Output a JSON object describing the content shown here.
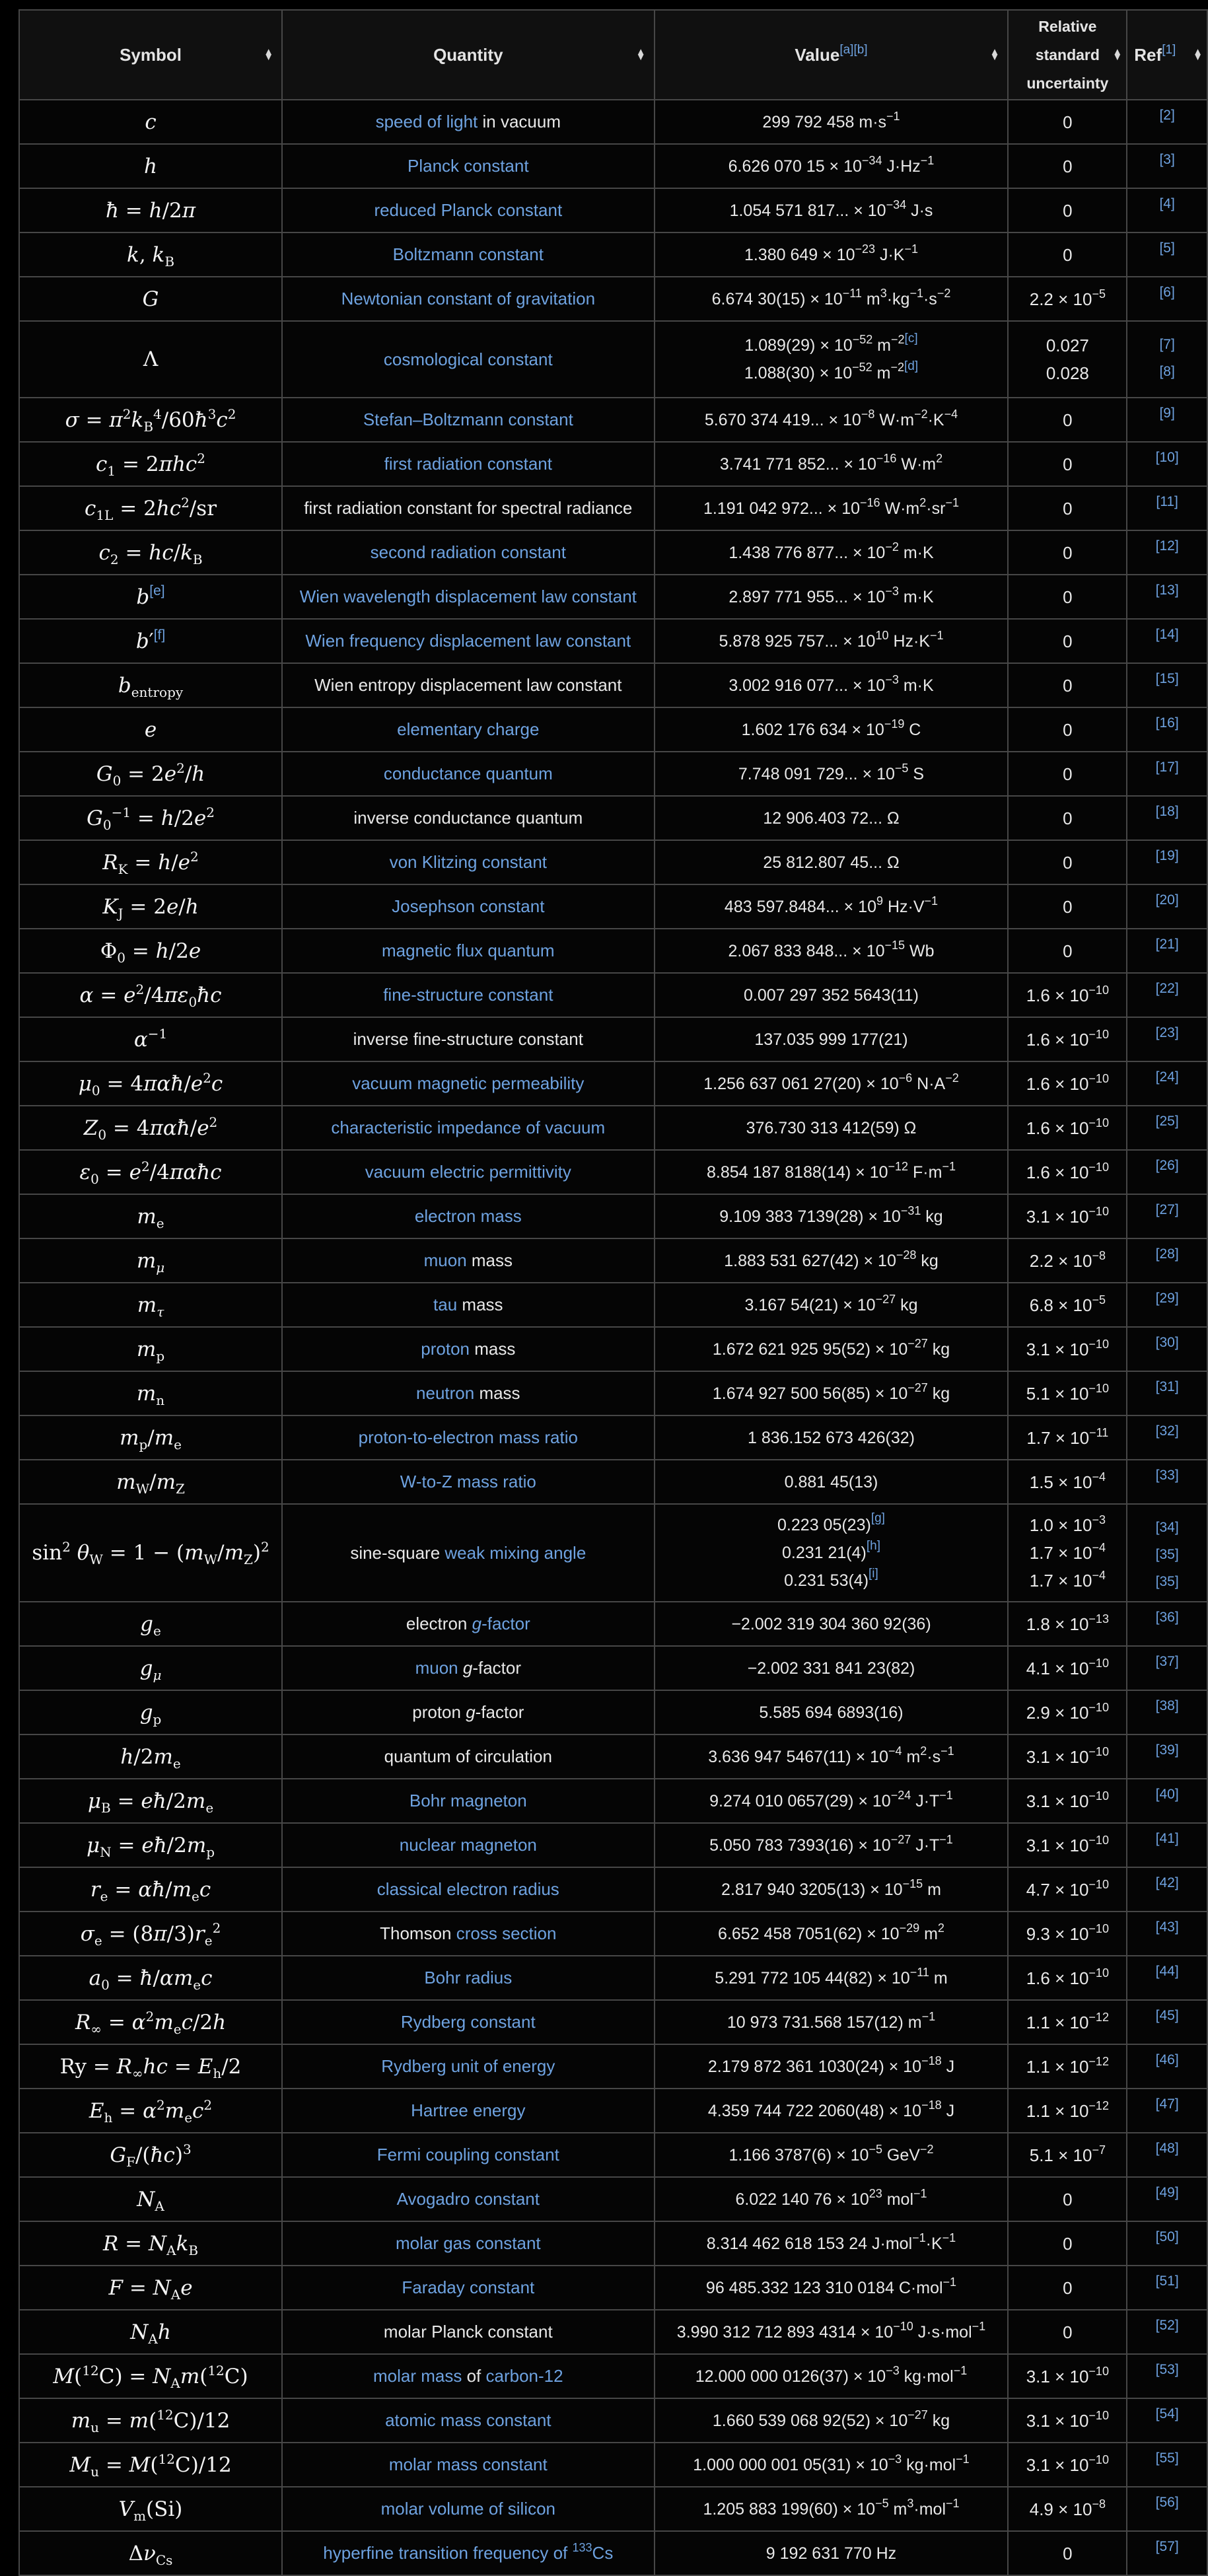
{
  "header": {
    "symbol": "Symbol",
    "quantity": "Quantity",
    "value": "Value",
    "value_notes": "[a][b]",
    "uncertainty_lines": [
      "Relative",
      "standard",
      "uncertainty"
    ],
    "ref": "Ref",
    "ref_note": "[1]",
    "sort_icon": "sort-updown-icon"
  },
  "colors": {
    "link": "#6ea2e0",
    "text": "#e8e8e8",
    "background": "#050505",
    "header_bg": "#101010",
    "border": "#474747"
  },
  "rows": [
    {
      "symbol": "<i>c</i>",
      "quantity": [
        [
          "link",
          "speed of light"
        ],
        [
          "plain",
          " in vacuum"
        ]
      ],
      "values": [
        "299 792 458 m·s^{−1}"
      ],
      "unc": [
        "0"
      ],
      "refs": [
        "[2]"
      ]
    },
    {
      "symbol": "<i>h</i>",
      "quantity": [
        [
          "link",
          "Planck constant"
        ]
      ],
      "values": [
        "6.626 070 15 × 10^{−34} J·Hz^{−1}"
      ],
      "unc": [
        "0"
      ],
      "refs": [
        "[3]"
      ]
    },
    {
      "symbol": "<i>ħ</i> = <i>h</i>/2<i>π</i>",
      "quantity": [
        [
          "link",
          "reduced Planck constant"
        ]
      ],
      "values": [
        "1.054 571 817... × 10^{−34} J·s"
      ],
      "unc": [
        "0"
      ],
      "refs": [
        "[4]"
      ]
    },
    {
      "symbol": "<i>k</i>, <i>k</i>_{B}",
      "quantity": [
        [
          "link",
          "Boltzmann constant"
        ]
      ],
      "values": [
        "1.380 649 × 10^{−23} J·K^{−1}"
      ],
      "unc": [
        "0"
      ],
      "refs": [
        "[5]"
      ]
    },
    {
      "symbol": "<i>G</i>",
      "quantity": [
        [
          "link",
          "Newtonian constant of gravitation"
        ]
      ],
      "values": [
        "6.674 30(15) × 10^{−11} m^{3}·kg^{−1}·s^{−2}"
      ],
      "unc": [
        "2.2 × 10^{−5}"
      ],
      "refs": [
        "[6]"
      ]
    },
    {
      "symbol": "Λ",
      "quantity": [
        [
          "link",
          "cosmological constant"
        ]
      ],
      "values": [
        "1.089(29) × 10^{−52} m^{−2}{fn:[c]}",
        "1.088(30) × 10^{−52} m^{−2}{fn:[d]}"
      ],
      "unc": [
        "0.027",
        "0.028"
      ],
      "refs": [
        "[7]",
        "[8]"
      ],
      "size": "mid"
    },
    {
      "symbol": "<i>σ</i> = <i>π</i>^{2}<i>k</i>_{B}^{4}/60<i>ħ</i>^{3}<i>c</i>^{2}",
      "quantity": [
        [
          "link",
          "Stefan–Boltzmann constant"
        ]
      ],
      "values": [
        "5.670 374 419... × 10^{−8} W·m^{−2}·K^{−4}"
      ],
      "unc": [
        "0"
      ],
      "refs": [
        "[9]"
      ]
    },
    {
      "symbol": "<i>c</i>_{1} = 2<i>πhc</i>^{2}",
      "quantity": [
        [
          "link",
          "first radiation constant"
        ]
      ],
      "values": [
        "3.741 771 852... × 10^{−16} W·m^{2}"
      ],
      "unc": [
        "0"
      ],
      "refs": [
        "[10]"
      ]
    },
    {
      "symbol": "<i>c</i>_{1L} = 2<i>hc</i>^{2}/sr",
      "quantity": [
        [
          "plain",
          "first radiation constant for spectral radiance"
        ]
      ],
      "values": [
        "1.191 042 972... × 10^{−16} W·m^{2}·sr^{−1}"
      ],
      "unc": [
        "0"
      ],
      "refs": [
        "[11]"
      ]
    },
    {
      "symbol": "<i>c</i>_{2} = <i>hc</i>/<i>k</i>_{B}",
      "quantity": [
        [
          "link",
          "second radiation constant"
        ]
      ],
      "values": [
        "1.438 776 877... × 10^{−2} m·K"
      ],
      "unc": [
        "0"
      ],
      "refs": [
        "[12]"
      ]
    },
    {
      "symbol": "<i>b</i>{fn:[e]}",
      "quantity": [
        [
          "link",
          "Wien wavelength displacement law constant"
        ]
      ],
      "values": [
        "2.897 771 955... × 10^{−3} m·K"
      ],
      "unc": [
        "0"
      ],
      "refs": [
        "[13]"
      ]
    },
    {
      "symbol": "<i>b</i>′{fn:[f]}",
      "quantity": [
        [
          "link",
          "Wien frequency displacement law constant"
        ]
      ],
      "values": [
        "5.878 925 757... × 10^{10} Hz·K^{−1}"
      ],
      "unc": [
        "0"
      ],
      "refs": [
        "[14]"
      ]
    },
    {
      "symbol": "<i>b</i>_{entropy}",
      "quantity": [
        [
          "plain",
          "Wien entropy displacement law constant"
        ]
      ],
      "values": [
        "3.002 916 077... × 10^{−3} m·K"
      ],
      "unc": [
        "0"
      ],
      "refs": [
        "[15]"
      ]
    },
    {
      "symbol": "<i>e</i>",
      "quantity": [
        [
          "link",
          "elementary charge"
        ]
      ],
      "values": [
        "1.602 176 634 × 10^{−19} C"
      ],
      "unc": [
        "0"
      ],
      "refs": [
        "[16]"
      ]
    },
    {
      "symbol": "<i>G</i>_{0} = 2<i>e</i>^{2}/<i>h</i>",
      "quantity": [
        [
          "link",
          "conductance quantum"
        ]
      ],
      "values": [
        "7.748 091 729... × 10^{−5} S"
      ],
      "unc": [
        "0"
      ],
      "refs": [
        "[17]"
      ]
    },
    {
      "symbol": "<i>G</i>_{0}^{−1} = <i>h</i>/2<i>e</i>^{2}",
      "quantity": [
        [
          "plain",
          "inverse conductance quantum"
        ]
      ],
      "values": [
        "12 906.403 72... Ω"
      ],
      "unc": [
        "0"
      ],
      "refs": [
        "[18]"
      ]
    },
    {
      "symbol": "<i>R</i>_{K} = <i>h</i>/<i>e</i>^{2}",
      "quantity": [
        [
          "link",
          "von Klitzing constant"
        ]
      ],
      "values": [
        "25 812.807 45... Ω"
      ],
      "unc": [
        "0"
      ],
      "refs": [
        "[19]"
      ]
    },
    {
      "symbol": "<i>K</i>_{J} = 2<i>e</i>/<i>h</i>",
      "quantity": [
        [
          "link",
          "Josephson constant"
        ]
      ],
      "values": [
        "483 597.8484... × 10^{9} Hz·V^{−1}"
      ],
      "unc": [
        "0"
      ],
      "refs": [
        "[20]"
      ]
    },
    {
      "symbol": "Φ_{0} = <i>h</i>/2<i>e</i>",
      "quantity": [
        [
          "link",
          "magnetic flux quantum"
        ]
      ],
      "values": [
        "2.067 833 848... × 10^{−15} Wb"
      ],
      "unc": [
        "0"
      ],
      "refs": [
        "[21]"
      ]
    },
    {
      "symbol": "<i>α</i> = <i>e</i>^{2}/4<i>πε</i>_{0}<i>ħc</i>",
      "quantity": [
        [
          "link",
          "fine-structure constant"
        ]
      ],
      "values": [
        "0.007 297 352 5643(11)"
      ],
      "unc": [
        "1.6 × 10^{−10}"
      ],
      "refs": [
        "[22]"
      ]
    },
    {
      "symbol": "<i>α</i>^{−1}",
      "quantity": [
        [
          "plain",
          "inverse fine-structure constant"
        ]
      ],
      "values": [
        "137.035 999 177(21)"
      ],
      "unc": [
        "1.6 × 10^{−10}"
      ],
      "refs": [
        "[23]"
      ]
    },
    {
      "symbol": "<i>μ</i>_{0} = 4<i>παħ</i>/<i>e</i>^{2}<i>c</i>",
      "quantity": [
        [
          "link",
          "vacuum magnetic permeability"
        ]
      ],
      "values": [
        "1.256 637 061 27(20) × 10^{−6} N·A^{−2}"
      ],
      "unc": [
        "1.6 × 10^{−10}"
      ],
      "refs": [
        "[24]"
      ]
    },
    {
      "symbol": "<i>Z</i>_{0} = 4<i>παħ</i>/<i>e</i>^{2}",
      "quantity": [
        [
          "link",
          "characteristic impedance of vacuum"
        ]
      ],
      "values": [
        "376.730 313 412(59) Ω"
      ],
      "unc": [
        "1.6 × 10^{−10}"
      ],
      "refs": [
        "[25]"
      ]
    },
    {
      "symbol": "<i>ε</i>_{0} = <i>e</i>^{2}/4<i>παħc</i>",
      "quantity": [
        [
          "link",
          "vacuum electric permittivity"
        ]
      ],
      "values": [
        "8.854 187 8188(14) × 10^{−12} F·m^{−1}"
      ],
      "unc": [
        "1.6 × 10^{−10}"
      ],
      "refs": [
        "[26]"
      ]
    },
    {
      "symbol": "<i>m</i>_{e}",
      "quantity": [
        [
          "link",
          "electron mass"
        ]
      ],
      "values": [
        "9.109 383 7139(28) × 10^{−31} kg"
      ],
      "unc": [
        "3.1 × 10^{−10}"
      ],
      "refs": [
        "[27]"
      ]
    },
    {
      "symbol": "<i>m</i>_{<i>μ</i>}",
      "quantity": [
        [
          "link",
          "muon"
        ],
        [
          "plain",
          " mass"
        ]
      ],
      "values": [
        "1.883 531 627(42) × 10^{−28} kg"
      ],
      "unc": [
        "2.2 × 10^{−8}"
      ],
      "refs": [
        "[28]"
      ]
    },
    {
      "symbol": "<i>m</i>_{<i>τ</i>}",
      "quantity": [
        [
          "link",
          "tau"
        ],
        [
          "plain",
          " mass"
        ]
      ],
      "values": [
        "3.167 54(21) × 10^{−27} kg"
      ],
      "unc": [
        "6.8 × 10^{−5}"
      ],
      "refs": [
        "[29]"
      ]
    },
    {
      "symbol": "<i>m</i>_{p}",
      "quantity": [
        [
          "link",
          "proton"
        ],
        [
          "plain",
          " mass"
        ]
      ],
      "values": [
        "1.672 621 925 95(52) × 10^{−27} kg"
      ],
      "unc": [
        "3.1 × 10^{−10}"
      ],
      "refs": [
        "[30]"
      ]
    },
    {
      "symbol": "<i>m</i>_{n}",
      "quantity": [
        [
          "link",
          "neutron"
        ],
        [
          "plain",
          " mass"
        ]
      ],
      "values": [
        "1.674 927 500 56(85) × 10^{−27} kg"
      ],
      "unc": [
        "5.1 × 10^{−10}"
      ],
      "refs": [
        "[31]"
      ]
    },
    {
      "symbol": "<i>m</i>_{p}/<i>m</i>_{e}",
      "quantity": [
        [
          "link",
          "proton-to-electron mass ratio"
        ]
      ],
      "values": [
        "1 836.152 673 426(32)"
      ],
      "unc": [
        "1.7 × 10^{−11}"
      ],
      "refs": [
        "[32]"
      ]
    },
    {
      "symbol": "<i>m</i>_{W}/<i>m</i>_{Z}",
      "quantity": [
        [
          "link",
          "W-to-Z mass ratio"
        ]
      ],
      "values": [
        "0.881 45(13)"
      ],
      "unc": [
        "1.5 × 10^{−4}"
      ],
      "refs": [
        "[33]"
      ]
    },
    {
      "symbol": "sin^{2} <i>θ</i>_{W} = 1 − (<i>m</i>_{W}/<i>m</i>_{Z})^{2}",
      "quantity": [
        [
          "plain",
          "sine-square "
        ],
        [
          "link",
          "weak mixing angle"
        ]
      ],
      "values": [
        "0.223 05(23){fn:[g]}",
        "0.231 21(4){fn:[h]}",
        "0.231 53(4){fn:[i]}"
      ],
      "unc": [
        "1.0 × 10^{−3}",
        "1.7 × 10^{−4}",
        "1.7 × 10^{−4}"
      ],
      "refs": [
        "[34]",
        "[35]",
        "[35]"
      ],
      "size": "tall"
    },
    {
      "symbol": "<i>g</i>_{e}",
      "quantity": [
        [
          "plain",
          "electron "
        ],
        [
          "link-it",
          "g"
        ],
        [
          "link",
          "-factor"
        ]
      ],
      "values": [
        "−2.002 319 304 360 92(36)"
      ],
      "unc": [
        "1.8 × 10^{−13}"
      ],
      "refs": [
        "[36]"
      ]
    },
    {
      "symbol": "<i>g</i>_{<i>μ</i>}",
      "quantity": [
        [
          "link",
          "muon "
        ],
        [
          "plain-it",
          "g"
        ],
        [
          "plain",
          "-factor"
        ]
      ],
      "values": [
        "−2.002 331 841 23(82)"
      ],
      "unc": [
        "4.1 × 10^{−10}"
      ],
      "refs": [
        "[37]"
      ]
    },
    {
      "symbol": "<i>g</i>_{p}",
      "quantity": [
        [
          "plain",
          "proton "
        ],
        [
          "plain-it",
          "g"
        ],
        [
          "plain",
          "-factor"
        ]
      ],
      "values": [
        "5.585 694 6893(16)"
      ],
      "unc": [
        "2.9 × 10^{−10}"
      ],
      "refs": [
        "[38]"
      ]
    },
    {
      "symbol": "<i>h</i>/2<i>m</i>_{e}",
      "quantity": [
        [
          "plain",
          "quantum of circulation"
        ]
      ],
      "values": [
        "3.636 947 5467(11) × 10^{−4} m^{2}·s^{−1}"
      ],
      "unc": [
        "3.1 × 10^{−10}"
      ],
      "refs": [
        "[39]"
      ]
    },
    {
      "symbol": "<i>μ</i>_{B} = <i>eħ</i>/2<i>m</i>_{e}",
      "quantity": [
        [
          "link",
          "Bohr magneton"
        ]
      ],
      "values": [
        "9.274 010 0657(29) × 10^{−24} J·T^{−1}"
      ],
      "unc": [
        "3.1 × 10^{−10}"
      ],
      "refs": [
        "[40]"
      ]
    },
    {
      "symbol": "<i>μ</i>_{N} = <i>eħ</i>/2<i>m</i>_{p}",
      "quantity": [
        [
          "link",
          "nuclear magneton"
        ]
      ],
      "values": [
        "5.050 783 7393(16) × 10^{−27} J·T^{−1}"
      ],
      "unc": [
        "3.1 × 10^{−10}"
      ],
      "refs": [
        "[41]"
      ]
    },
    {
      "symbol": "<i>r</i>_{e} = <i>αħ</i>/<i>m</i>_{e}<i>c</i>",
      "quantity": [
        [
          "link",
          "classical electron radius"
        ]
      ],
      "values": [
        "2.817 940 3205(13) × 10^{−15} m"
      ],
      "unc": [
        "4.7 × 10^{−10}"
      ],
      "refs": [
        "[42]"
      ]
    },
    {
      "symbol": "<i>σ</i>_{e} = (8<i>π</i>/3)<i>r</i>_{e}^{2}",
      "quantity": [
        [
          "plain",
          "Thomson "
        ],
        [
          "link",
          "cross section"
        ]
      ],
      "values": [
        "6.652 458 7051(62) × 10^{−29} m^{2}"
      ],
      "unc": [
        "9.3 × 10^{−10}"
      ],
      "refs": [
        "[43]"
      ]
    },
    {
      "symbol": "<i>a</i>_{0} = <i>ħ</i>/<i>αm</i>_{e}<i>c</i>",
      "quantity": [
        [
          "link",
          "Bohr radius"
        ]
      ],
      "values": [
        "5.291 772 105 44(82) × 10^{−11} m"
      ],
      "unc": [
        "1.6 × 10^{−10}"
      ],
      "refs": [
        "[44]"
      ]
    },
    {
      "symbol": "<i>R</i>_{∞} = <i>α</i>^{2}<i>m</i>_{e}<i>c</i>/2<i>h</i>",
      "quantity": [
        [
          "link",
          "Rydberg constant"
        ]
      ],
      "values": [
        "10 973 731.568 157(12) m^{−1}"
      ],
      "unc": [
        "1.1 × 10^{−12}"
      ],
      "refs": [
        "[45]"
      ]
    },
    {
      "symbol": "Ry = <i>R</i>_{∞}<i>hc</i> = <i>E</i>_{h}/2",
      "quantity": [
        [
          "link",
          "Rydberg unit of energy"
        ]
      ],
      "values": [
        "2.179 872 361 1030(24) × 10^{−18} J"
      ],
      "unc": [
        "1.1 × 10^{−12}"
      ],
      "refs": [
        "[46]"
      ]
    },
    {
      "symbol": "<i>E</i>_{h} = <i>α</i>^{2}<i>m</i>_{e}<i>c</i>^{2}",
      "quantity": [
        [
          "link",
          "Hartree energy"
        ]
      ],
      "values": [
        "4.359 744 722 2060(48) × 10^{−18} J"
      ],
      "unc": [
        "1.1 × 10^{−12}"
      ],
      "refs": [
        "[47]"
      ]
    },
    {
      "symbol": "<i>G</i>_{F}/(<i>ħc</i>)^{3}",
      "quantity": [
        [
          "link",
          "Fermi coupling constant"
        ]
      ],
      "values": [
        "1.166 3787(6) × 10^{−5} GeV^{−2}"
      ],
      "unc": [
        "5.1 × 10^{−7}"
      ],
      "refs": [
        "[48]"
      ]
    },
    {
      "symbol": "<i>N</i>_{A}",
      "quantity": [
        [
          "link",
          "Avogadro constant"
        ]
      ],
      "values": [
        "6.022 140 76 × 10^{23} mol^{−1}"
      ],
      "unc": [
        "0"
      ],
      "refs": [
        "[49]"
      ]
    },
    {
      "symbol": "<i>R</i> = <i>N</i>_{A}<i>k</i>_{B}",
      "quantity": [
        [
          "link",
          "molar gas constant"
        ]
      ],
      "values": [
        "8.314 462 618 153 24 J·mol^{−1}·K^{−1}"
      ],
      "unc": [
        "0"
      ],
      "refs": [
        "[50]"
      ]
    },
    {
      "symbol": "<i>F</i> = <i>N</i>_{A}<i>e</i>",
      "quantity": [
        [
          "link",
          "Faraday constant"
        ]
      ],
      "values": [
        "96 485.332 123 310 0184 C·mol^{−1}"
      ],
      "unc": [
        "0"
      ],
      "refs": [
        "[51]"
      ]
    },
    {
      "symbol": "<i>N</i>_{A}<i>h</i>",
      "quantity": [
        [
          "plain",
          "molar Planck constant"
        ]
      ],
      "values": [
        "3.990 312 712 893 4314 × 10^{−10} J·s·mol^{−1}"
      ],
      "unc": [
        "0"
      ],
      "refs": [
        "[52]"
      ]
    },
    {
      "symbol": "<i>M</i>(^{12}C) = <i>N</i>_{A}<i>m</i>(^{12}C)",
      "quantity": [
        [
          "link",
          "molar mass"
        ],
        [
          "plain",
          " of "
        ],
        [
          "link",
          "carbon-12"
        ]
      ],
      "values": [
        "12.000 000 0126(37) × 10^{−3} kg·mol^{−1}"
      ],
      "unc": [
        "3.1 × 10^{−10}"
      ],
      "refs": [
        "[53]"
      ]
    },
    {
      "symbol": "<i>m</i>_{u} = <i>m</i>(^{12}C)/12",
      "quantity": [
        [
          "link",
          "atomic mass constant"
        ]
      ],
      "values": [
        "1.660 539 068 92(52) × 10^{−27} kg"
      ],
      "unc": [
        "3.1 × 10^{−10}"
      ],
      "refs": [
        "[54]"
      ]
    },
    {
      "symbol": "<i>M</i>_{u} = <i>M</i>(^{12}C)/12",
      "quantity": [
        [
          "link",
          "molar mass constant"
        ]
      ],
      "values": [
        "1.000 000 001 05(31) × 10^{−3} kg·mol^{−1}"
      ],
      "unc": [
        "3.1 × 10^{−10}"
      ],
      "refs": [
        "[55]"
      ]
    },
    {
      "symbol": "<i>V</i>_{m}(Si)",
      "quantity": [
        [
          "link",
          "molar volume of silicon"
        ]
      ],
      "values": [
        "1.205 883 199(60) × 10^{−5} m^{3}·mol^{−1}"
      ],
      "unc": [
        "4.9 × 10^{−8}"
      ],
      "refs": [
        "[56]"
      ]
    },
    {
      "symbol": "Δ<i>ν</i>_{Cs}",
      "quantity": [
        [
          "link",
          "hyperfine transition frequency of ^{133}Cs"
        ]
      ],
      "values": [
        "9 192 631 770 Hz"
      ],
      "unc": [
        "0"
      ],
      "refs": [
        "[57]"
      ]
    }
  ]
}
